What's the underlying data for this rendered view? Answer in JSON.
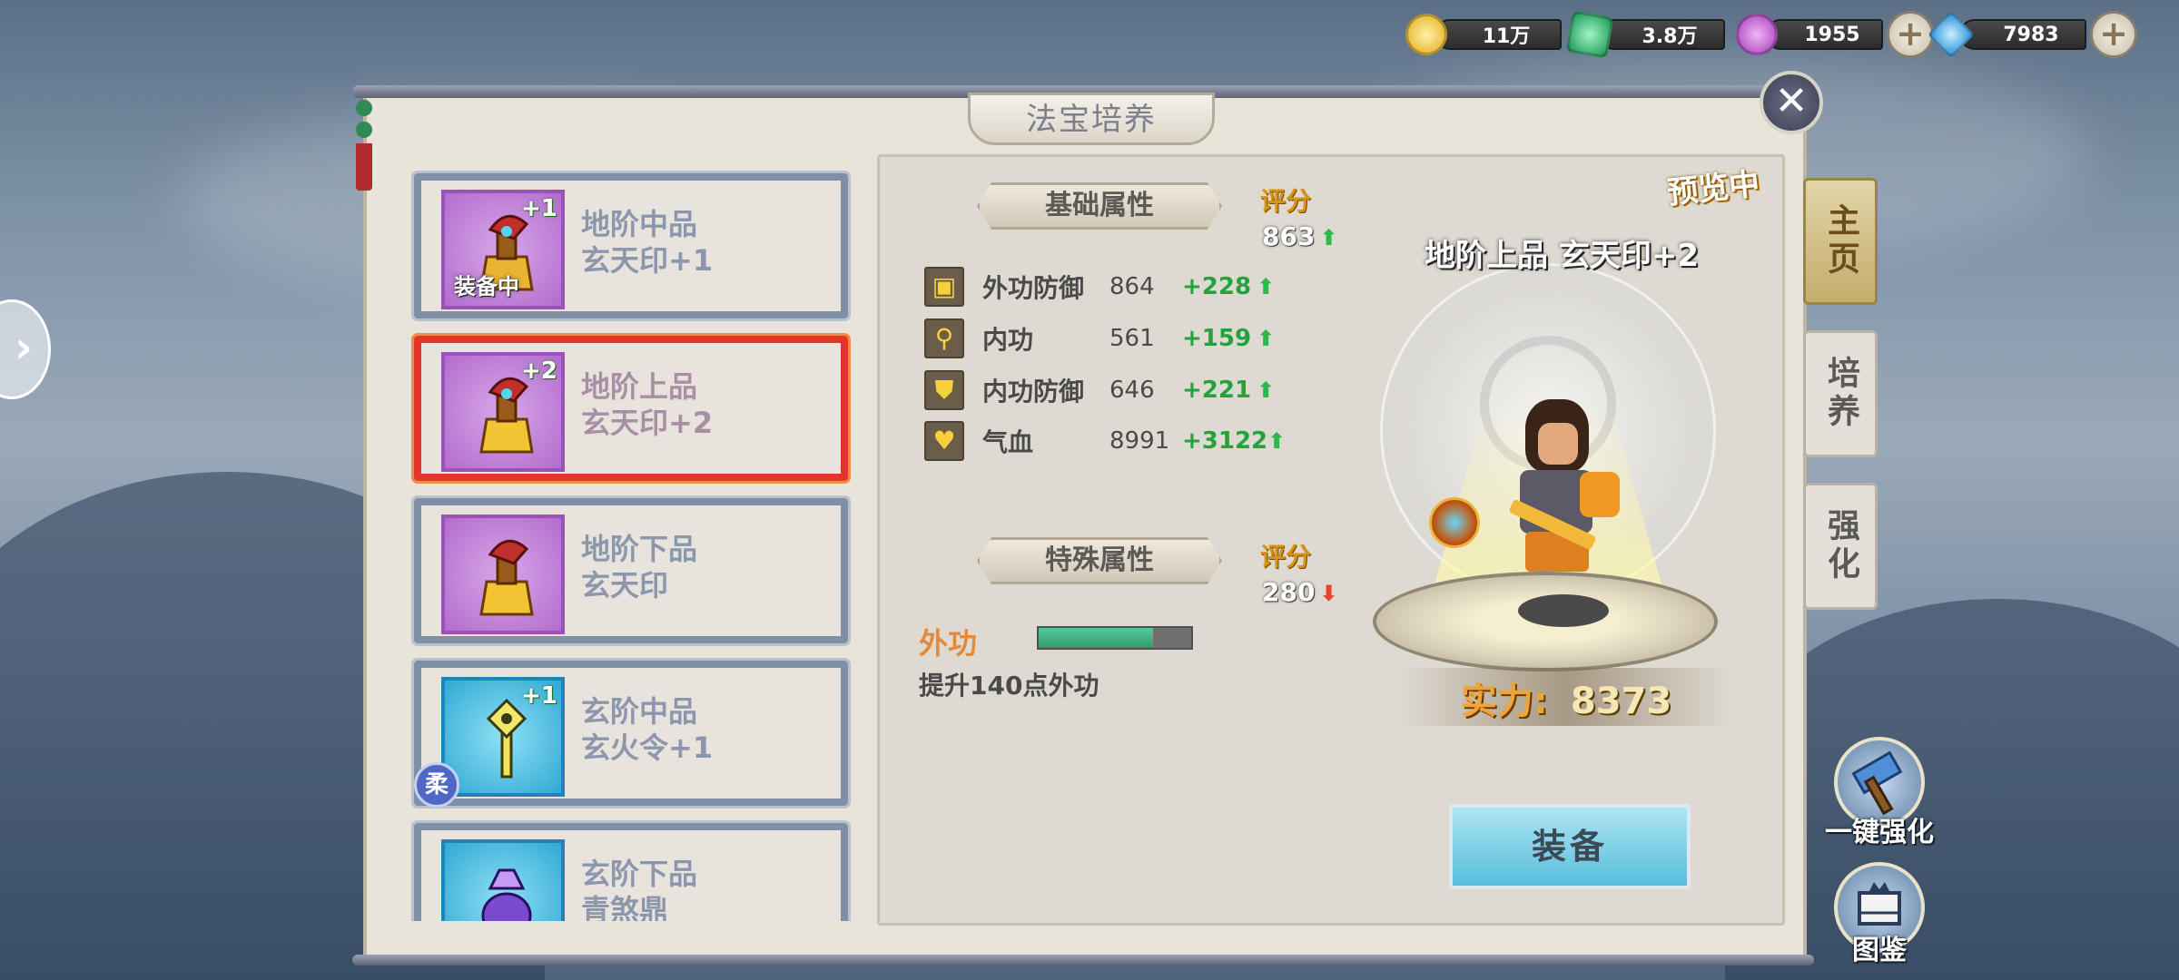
{
  "currencies": [
    {
      "icon": "gold-coin-icon",
      "value": "11万",
      "color": "#f2c12e"
    },
    {
      "icon": "jade-icon",
      "value": "3.8万",
      "color": "#3cc37a"
    },
    {
      "icon": "spirit-orb-icon",
      "value": "1955",
      "color": "#c86bd6"
    },
    {
      "icon": "diamond-icon",
      "value": "7983",
      "color": "#4fb7f0"
    }
  ],
  "panel_title": "法宝培养",
  "items": [
    {
      "grade": "地阶中品",
      "name": "玄天印+1",
      "plus": "+1",
      "tag": "装备中",
      "selected": false
    },
    {
      "grade": "地阶上品",
      "name": "玄天印+2",
      "plus": "+2",
      "tag": "",
      "selected": true
    },
    {
      "grade": "地阶下品",
      "name": "玄天印",
      "plus": "",
      "tag": "",
      "selected": false
    },
    {
      "grade": "玄阶中品",
      "name": "玄火令+1",
      "plus": "+1",
      "tag": "",
      "selected": false,
      "corner": "柔"
    },
    {
      "grade": "玄阶下品",
      "name": "青煞鼎",
      "plus": "",
      "tag": "",
      "selected": false
    }
  ],
  "basic": {
    "header": "基础属性",
    "score_label": "评分",
    "score": "863",
    "stats": [
      {
        "name": "外功防御",
        "value": "864",
        "add": "+228"
      },
      {
        "name": "内功",
        "value": "561",
        "add": "+159"
      },
      {
        "name": "内功防御",
        "value": "646",
        "add": "+221"
      },
      {
        "name": "气血",
        "value": "8991",
        "add": "+3122"
      }
    ]
  },
  "special": {
    "header": "特殊属性",
    "score_label": "评分",
    "score": "280",
    "attr_name": "外功",
    "progress": 0.75,
    "desc": "提升140点外功"
  },
  "preview": {
    "badge": "预览中",
    "title": "地阶上品 玄天印+2",
    "power_label": "实力:",
    "power_value": "8373",
    "equip_label": "装备"
  },
  "side_tabs": [
    "主页",
    "培养",
    "强化"
  ],
  "float_buttons": [
    {
      "label": "一键强化",
      "icon": "hammer-icon"
    },
    {
      "label": "图鉴",
      "icon": "book-icon"
    }
  ],
  "close_label": "✕"
}
